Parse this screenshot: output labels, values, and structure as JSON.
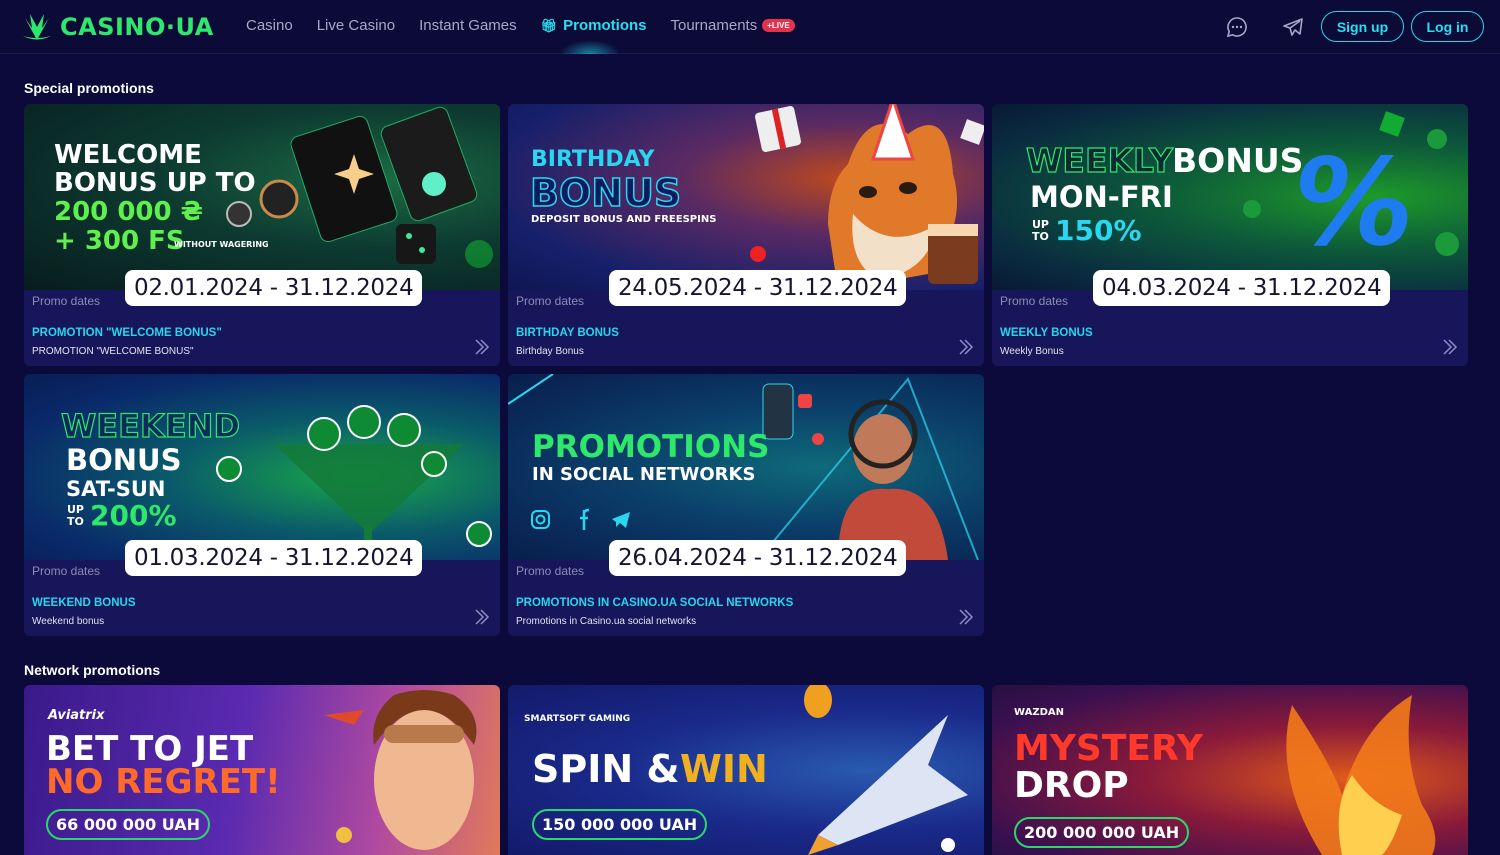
{
  "header": {
    "logo_text": "CASINO·UA",
    "nav": [
      {
        "label": "Casino"
      },
      {
        "label": "Live Casino"
      },
      {
        "label": "Instant Games"
      },
      {
        "label": "Promotions",
        "active": true
      },
      {
        "label": "Tournaments",
        "badge": "+LIVE"
      }
    ],
    "signup_label": "Sign up",
    "login_label": "Log in"
  },
  "sections": {
    "special_title": "Special promotions",
    "network_title": "Network promotions"
  },
  "promo_label": "Promo dates",
  "special_promos": [
    {
      "dates": "02.01.2024 - 31.12.2024",
      "title": "PROMOTION \"WELCOME BONUS\"",
      "subtitle": "PROMOTION \"WELCOME BONUS\"",
      "banner": {
        "line1": "WELCOME",
        "line2": "BONUS UP TO",
        "line3": "200 000 ₴",
        "line4": "+ 300 FS",
        "small": "WITHOUT WAGERING"
      }
    },
    {
      "dates": "24.05.2024 - 31.12.2024",
      "title": "BIRTHDAY BONUS",
      "subtitle": "Birthday Bonus",
      "banner": {
        "line1": "BIRTHDAY",
        "line2": "BONUS",
        "small": "DEPOSIT BONUS AND FREESPINS"
      }
    },
    {
      "dates": "04.03.2024 - 31.12.2024",
      "title": "WEEKLY BONUS",
      "subtitle": "Weekly Bonus",
      "banner": {
        "line1a": "WEEKLY",
        "line1b": "BONUS",
        "line2": "MON-FRI",
        "up": "UP",
        "to": "TO",
        "line3": "150%"
      }
    },
    {
      "dates": "01.03.2024 - 31.12.2024",
      "title": "WEEKEND BONUS",
      "subtitle": "Weekend bonus",
      "banner": {
        "line1": "WEEKEND",
        "line2": "BONUS",
        "line3": "SAT-SUN",
        "up": "UP",
        "to": "TO",
        "line4": "200%"
      }
    },
    {
      "dates": "26.04.2024 - 31.12.2024",
      "title": "PROMOTIONS IN CASINO.UA SOCIAL NETWORKS",
      "subtitle": "Promotions in Casino.ua social networks",
      "banner": {
        "line1": "PROMOTIONS",
        "line2": "IN SOCIAL NETWORKS"
      }
    }
  ],
  "network_promos": [
    {
      "brand": "Aviatrix",
      "line1": "BET TO JET",
      "line2": "NO REGRET!",
      "amount": "66 000 000 UAH"
    },
    {
      "brand": "SMARTSOFT GAMING",
      "line1": "SPIN &",
      "line1b": "WIN",
      "amount": "150 000 000 UAH"
    },
    {
      "brand": "WAZDAN",
      "line1": "MYSTERY",
      "line2": "DROP",
      "amount": "200 000 000 UAH"
    }
  ],
  "colors": {
    "accent": "#25e0f0",
    "brand_green": "#2ee86b",
    "background": "#0b0a3a"
  }
}
